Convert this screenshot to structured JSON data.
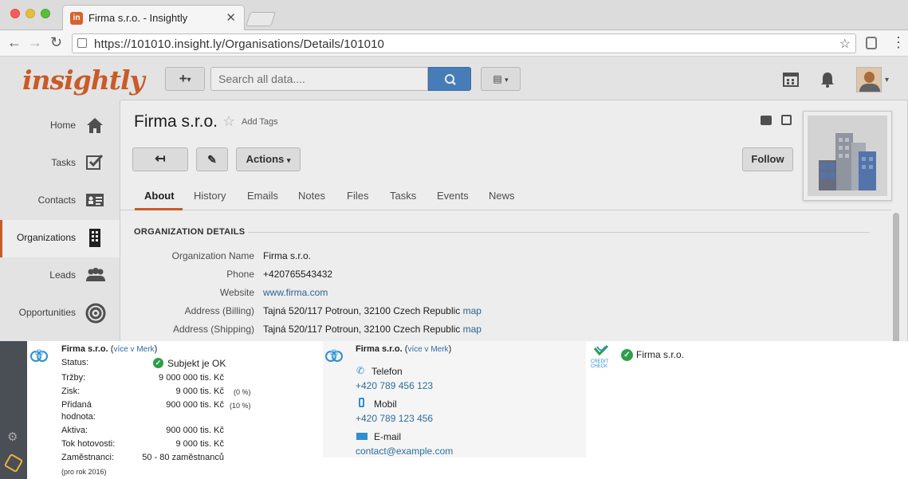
{
  "browser": {
    "tab_title": "Firma s.r.o. - Insightly",
    "tab_favicon": "in",
    "url": "https://101010.insight.ly/Organisations/Details/101010",
    "icons": [
      "back-arrow-icon",
      "forward-arrow-icon",
      "reload-icon",
      "star-icon",
      "extension-icon",
      "menu-icon"
    ]
  },
  "app": {
    "logo": "insightly",
    "brand_color": "#d9622b",
    "search_placeholder": "Search all data...."
  },
  "sidebar": {
    "items": [
      {
        "label": "Home",
        "icon": "home-icon"
      },
      {
        "label": "Tasks",
        "icon": "checkbox-icon"
      },
      {
        "label": "Contacts",
        "icon": "contact-card-icon"
      },
      {
        "label": "Organizations",
        "icon": "building-icon",
        "active": true
      },
      {
        "label": "Leads",
        "icon": "people-icon"
      },
      {
        "label": "Opportunities",
        "icon": "target-icon"
      }
    ]
  },
  "record": {
    "title": "Firma s.r.o.",
    "add_tags": "Add Tags",
    "actions_label": "Actions",
    "follow_label": "Follow",
    "tabs": [
      "About",
      "History",
      "Emails",
      "Notes",
      "Files",
      "Tasks",
      "Events",
      "News"
    ],
    "active_tab": "About",
    "section_title": "ORGANIZATION DETAILS",
    "details": [
      {
        "label": "Organization Name",
        "value": "Firma s.r.o."
      },
      {
        "label": "Phone",
        "value": "+420765543432"
      },
      {
        "label": "Website",
        "value": "www.firma.com"
      },
      {
        "label": "Address (Billing)",
        "value": "Tajná 520/117 Potroun, 32100 Czech Republic",
        "link": "map"
      },
      {
        "label": "Address (Shipping)",
        "value": "Tajná 520/117 Potroun, 32100 Czech Republic",
        "link": "map"
      }
    ]
  },
  "merk": {
    "company": "Firma s.r.o.",
    "more_link": "více v Merk",
    "paren_open": "(",
    "paren_close": ")",
    "status_label": "Status:",
    "status_value": "Subjekt je OK",
    "rows": [
      {
        "label": "Tržby:",
        "value": "9 000 000 tis. Kč",
        "pct": ""
      },
      {
        "label": "Zisk:",
        "value": "9 000 tis. Kč",
        "pct": "(0 %)"
      },
      {
        "label": "Přidaná",
        "label2": "hodnota:",
        "value": "900 000 tis. Kč",
        "pct": "(10 %)"
      },
      {
        "label": "Aktiva:",
        "value": "900 000 tis. Kč",
        "pct": ""
      },
      {
        "label": "Tok hotovosti:",
        "value": "9 000 tis. Kč",
        "pct": ""
      },
      {
        "label": "Zaměstnanci:",
        "value": "50 - 80 zaměstnanců",
        "pct": ""
      }
    ],
    "year_note": "(pro rok 2016)",
    "contacts": {
      "phone_label": "Telefon",
      "phone_value": "+420 789 456 123",
      "mobile_label": "Mobil",
      "mobile_value": "+420 789 123 456",
      "email_label": "E-mail",
      "email_value": "contact@example.com"
    },
    "credit_check": {
      "logo_text_1": "CREDIT",
      "logo_text_2": "CHECK",
      "company": "Firma s.r.o."
    },
    "status_color": "#2e9e49"
  }
}
